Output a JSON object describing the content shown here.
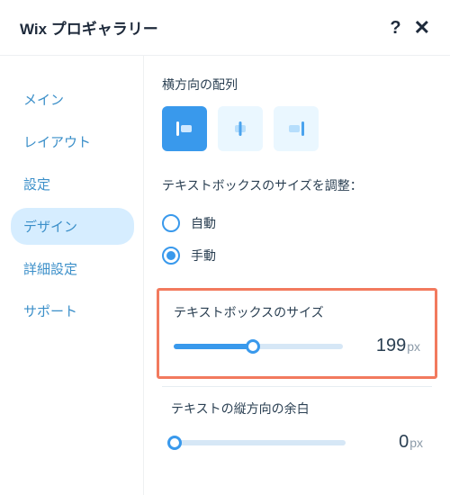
{
  "header": {
    "title": "Wix プロギャラリー"
  },
  "sidebar": {
    "items": [
      {
        "label": "メイン",
        "active": false
      },
      {
        "label": "レイアウト",
        "active": false
      },
      {
        "label": "設定",
        "active": false
      },
      {
        "label": "デザイン",
        "active": true
      },
      {
        "label": "詳細設定",
        "active": false
      },
      {
        "label": "サポート",
        "active": false
      }
    ]
  },
  "main": {
    "align_section_title": "横方向の配列",
    "align_options": [
      {
        "name": "align-left",
        "selected": true
      },
      {
        "name": "align-center",
        "selected": false
      },
      {
        "name": "align-right",
        "selected": false
      }
    ],
    "sizing_section_title": "テキストボックスのサイズを調整：",
    "sizing_mode": {
      "auto_label": "自動",
      "manual_label": "手動",
      "selected": "manual"
    },
    "textbox_size": {
      "title": "テキストボックスのサイズ",
      "value": 199,
      "unit": "px",
      "percent": 47
    },
    "vertical_margin": {
      "title": "テキストの縦方向の余白",
      "value": 0,
      "unit": "px",
      "percent": 2
    }
  }
}
